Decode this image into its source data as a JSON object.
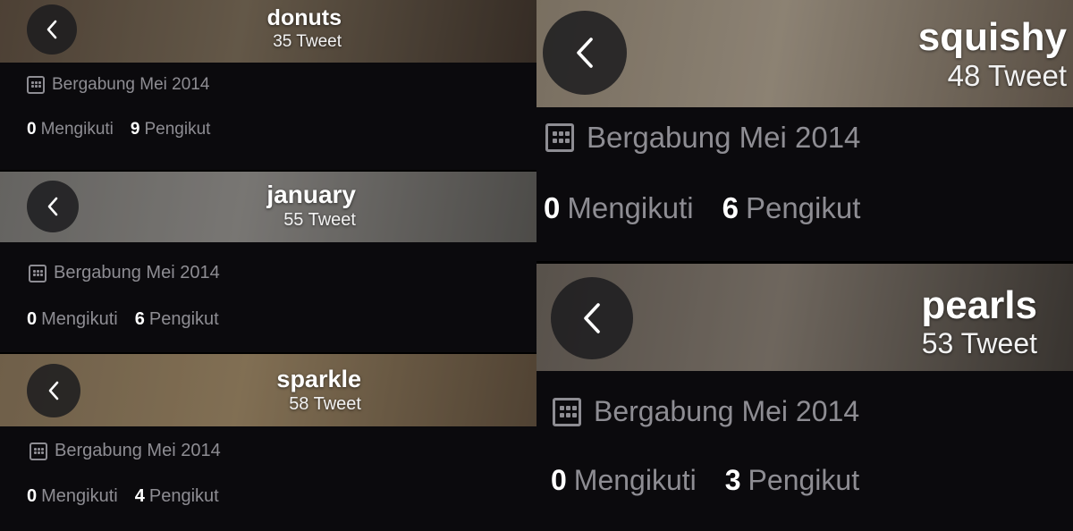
{
  "profiles": [
    {
      "name": "donuts",
      "tweet_count": "35 Tweet",
      "joined": "Bergabung Mei 2014",
      "following_count": "0",
      "following_label": "Mengikuti",
      "followers_count": "9",
      "followers_label": "Pengikut",
      "banner_colors": [
        "#6b5a4a",
        "#8a7a64",
        "#4a3d33"
      ]
    },
    {
      "name": "january",
      "tweet_count": "55 Tweet",
      "joined": "Bergabung Mei 2014",
      "following_count": "0",
      "following_label": "Mengikuti",
      "followers_count": "6",
      "followers_label": "Pengikut",
      "banner_colors": [
        "#8c8a86",
        "#a7a4a0",
        "#6a6864"
      ]
    },
    {
      "name": "sparkle",
      "tweet_count": "58 Tweet",
      "joined": "Bergabung Mei 2014",
      "following_count": "0",
      "following_label": "Mengikuti",
      "followers_count": "4",
      "followers_label": "Pengikut",
      "banner_colors": [
        "#9a8466",
        "#b39a74",
        "#6f5c47"
      ]
    },
    {
      "name": "squishy",
      "tweet_count": "48 Tweet",
      "joined": "Bergabung Mei 2014",
      "following_count": "0",
      "following_label": "Mengikuti",
      "followers_count": "6",
      "followers_label": "Pengikut",
      "banner_colors": [
        "#a89a86",
        "#c2b4a0",
        "#7d6f60"
      ]
    },
    {
      "name": "pearls",
      "tweet_count": "53 Tweet",
      "joined": "Bergabung Mei 2014",
      "following_count": "0",
      "following_label": "Mengikuti",
      "followers_count": "3",
      "followers_label": "Pengikut",
      "banner_colors": [
        "#7a7168",
        "#998e82",
        "#4e4842"
      ]
    }
  ],
  "colors": {
    "background": "#0b0a0d",
    "muted_text": "#8e8d93",
    "primary_text": "#ffffff",
    "back_button": "#1c1c1e"
  },
  "icons": {
    "back": "chevron-left-icon",
    "calendar": "calendar-icon"
  }
}
